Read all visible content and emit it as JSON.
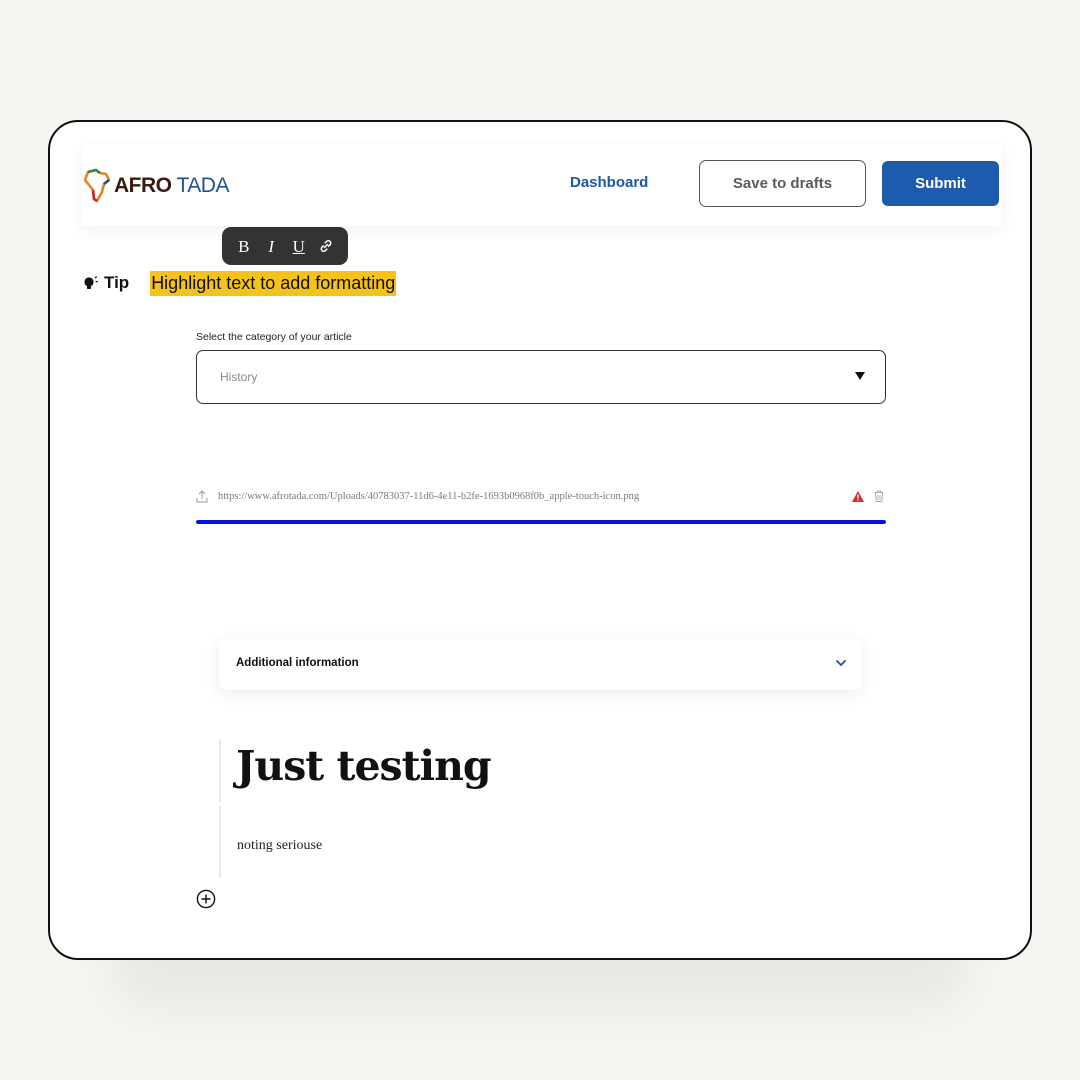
{
  "header": {
    "logo_afro": "AFRO",
    "logo_tada": "TADA",
    "dashboard_label": "Dashboard",
    "save_drafts_label": "Save to drafts",
    "submit_label": "Submit"
  },
  "format_toolbar": {
    "bold": "B",
    "italic": "I",
    "underline": "U",
    "link_icon": "link-icon"
  },
  "tip": {
    "label": "Tip",
    "text": "Highlight text to add formatting",
    "icon": "lightbulb-icon"
  },
  "category": {
    "label": "Select the category of your article",
    "selected": "History"
  },
  "upload": {
    "url": "https://www.afrotada.com/Uploads/40783037-11d6-4e11-b2fe-1693b0968f0b_apple-touch-icon.png",
    "progress_fraction": 1.0
  },
  "additional_info": {
    "label": "Additional information"
  },
  "article": {
    "title": "Just testing",
    "body": "noting seriouse"
  },
  "colors": {
    "brand_blue": "#1e5bad",
    "highlight_yellow": "#f5c21a",
    "progress_blue": "#0a12e0",
    "warning_red": "#d32f2f"
  }
}
